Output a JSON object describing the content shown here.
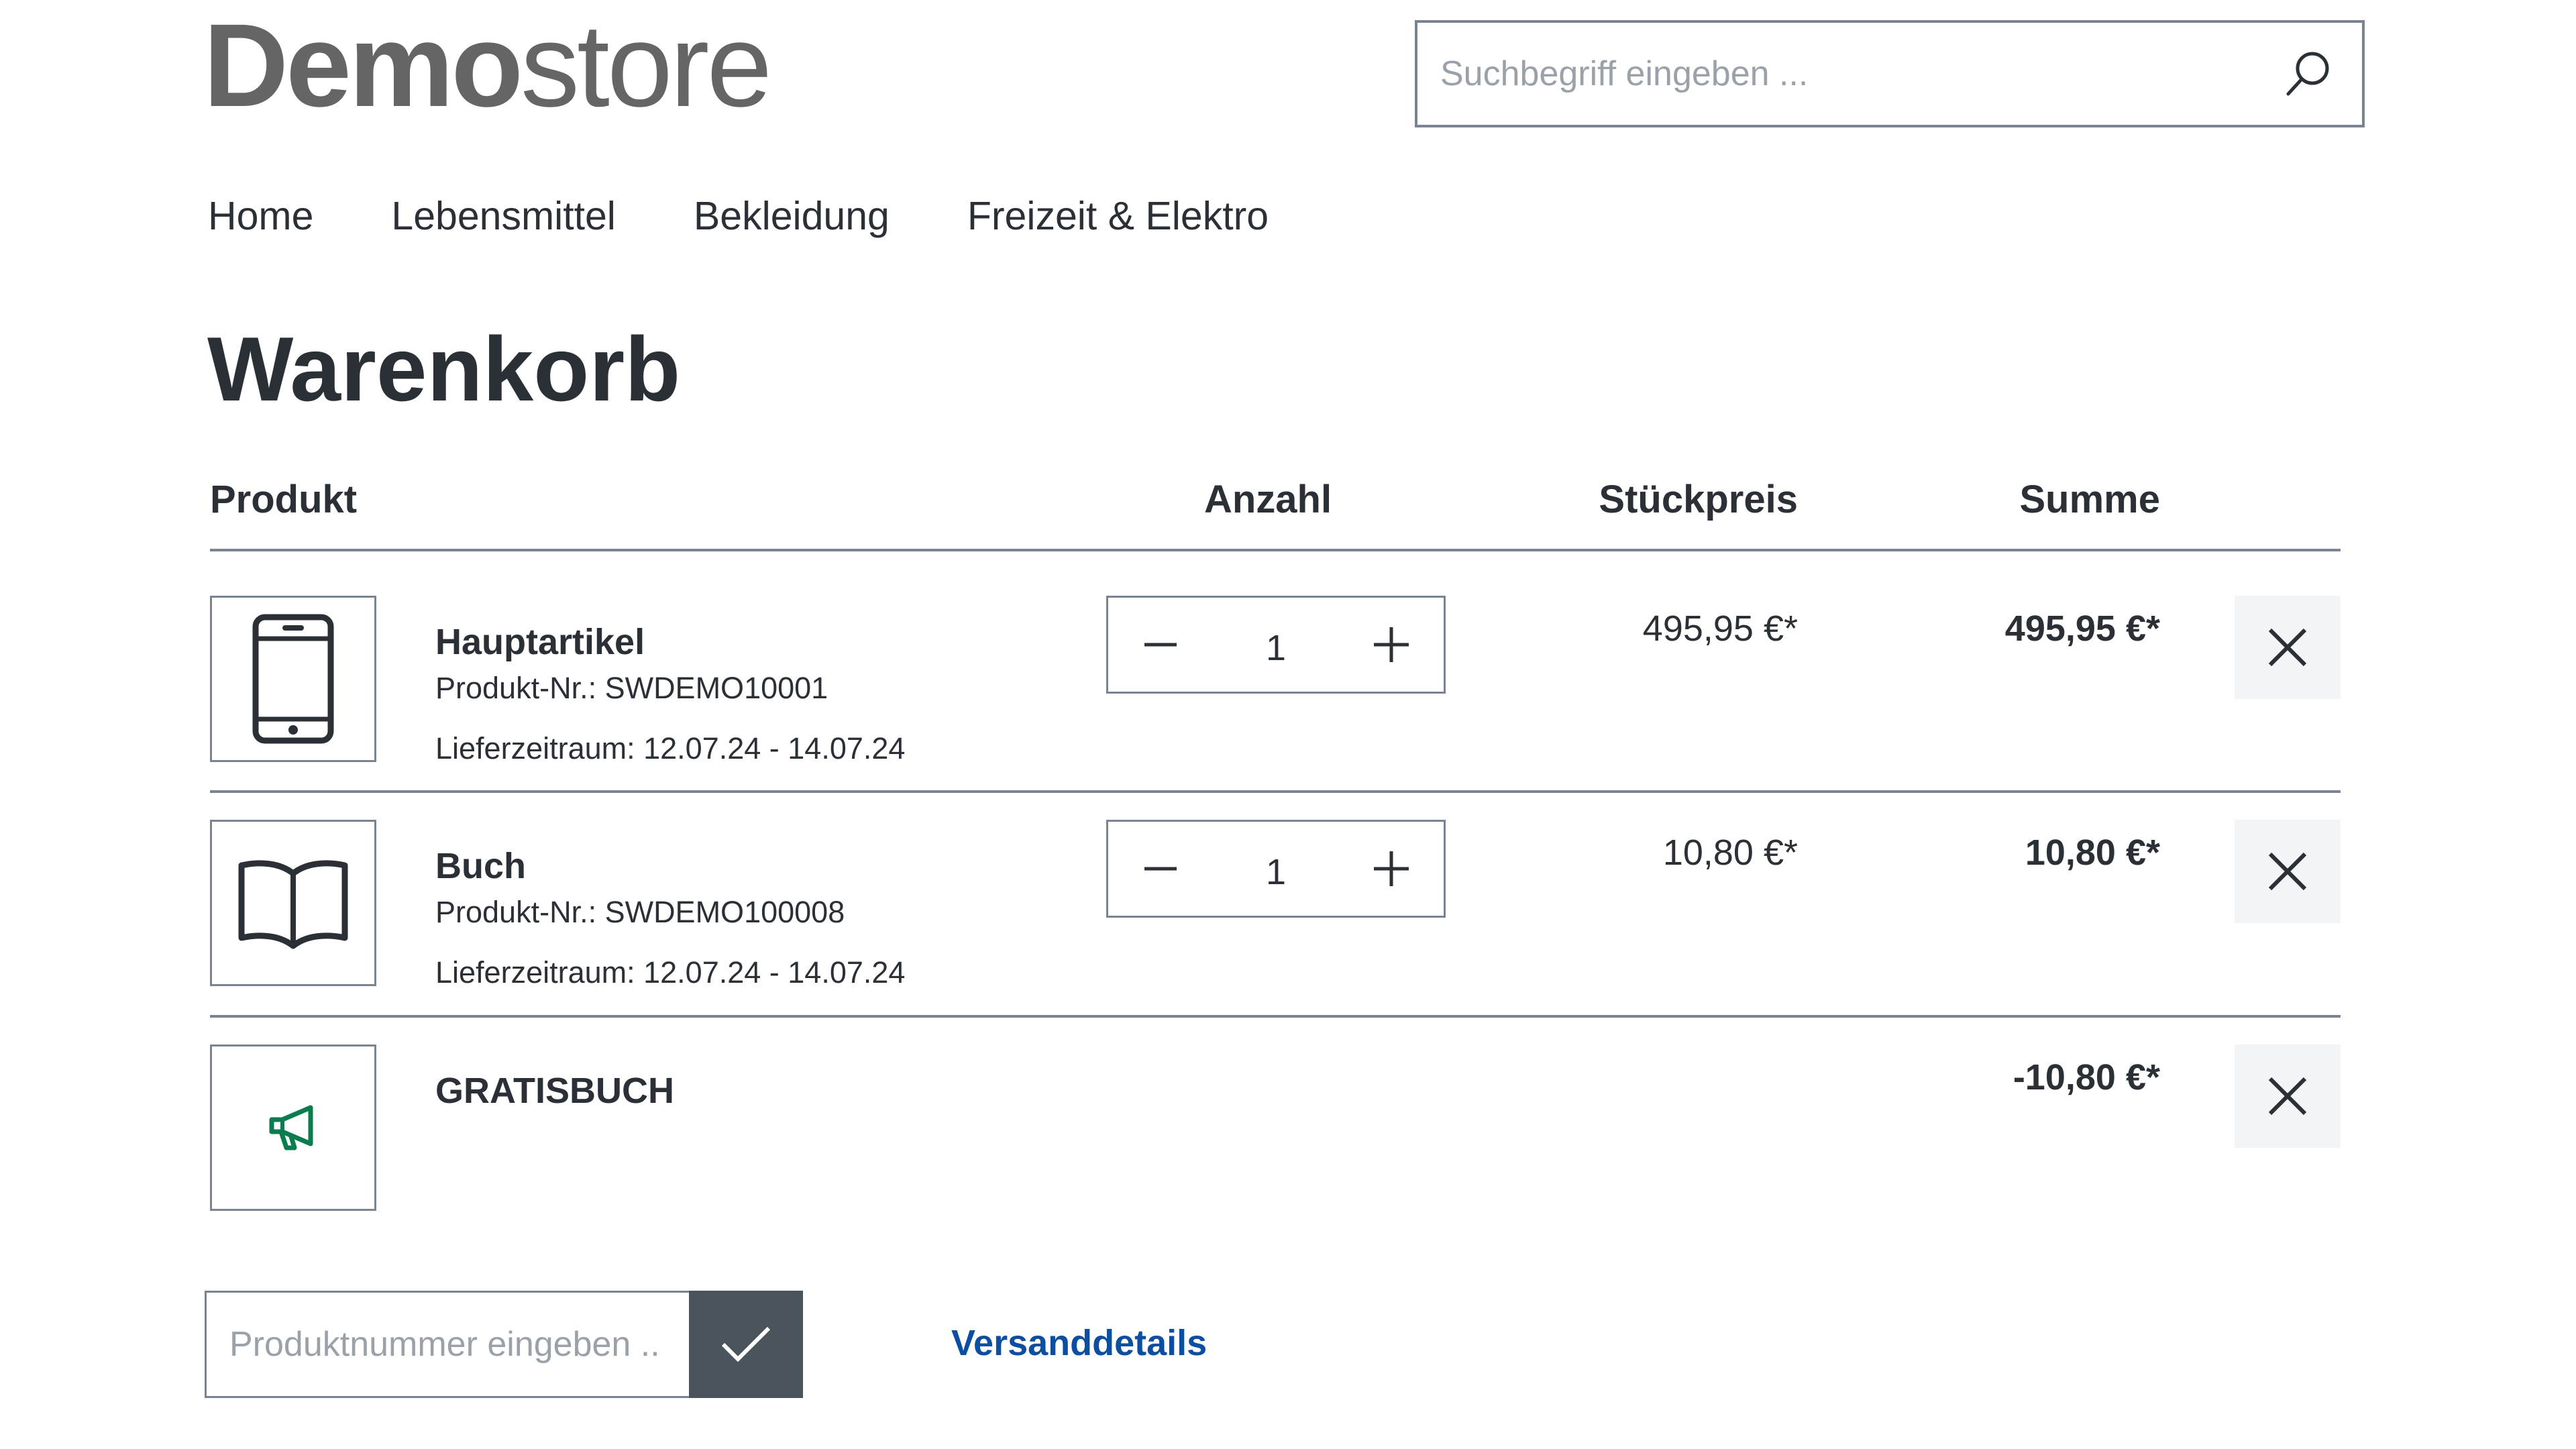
{
  "header": {
    "logo": {
      "bold": "Demo",
      "thin": "store"
    },
    "search": {
      "placeholder": "Suchbegriff eingeben ..."
    }
  },
  "nav": {
    "items": [
      {
        "label": "Home"
      },
      {
        "label": "Lebensmittel"
      },
      {
        "label": "Bekleidung"
      },
      {
        "label": "Freizeit & Elektro"
      }
    ]
  },
  "page": {
    "title": "Warenkorb"
  },
  "table": {
    "headers": {
      "product": "Produkt",
      "quantity": "Anzahl",
      "unit_price": "Stückpreis",
      "total": "Summe"
    }
  },
  "cart": {
    "items": [
      {
        "name": "Hauptartikel",
        "product_number": "Produkt-Nr.: SWDEMO10001",
        "delivery": "Lieferzeitraum: 12.07.24 - 14.07.24",
        "quantity": "1",
        "unit_price": "495,95 €*",
        "total": "495,95 €*",
        "icon": "smartphone-icon"
      },
      {
        "name": "Buch",
        "product_number": "Produkt-Nr.: SWDEMO100008",
        "delivery": "Lieferzeitraum: 12.07.24 - 14.07.24",
        "quantity": "1",
        "unit_price": "10,80 €*",
        "total": "10,80 €*",
        "icon": "book-icon"
      }
    ],
    "promotion": {
      "name": "GRATISBUCH",
      "total": "-10,80 €*",
      "icon": "megaphone-icon",
      "icon_color": "#0a7d4e"
    }
  },
  "actions": {
    "add_product_placeholder": "Produktnummer eingeben ..",
    "shipping_details": "Versanddetails"
  },
  "colors": {
    "text": "#2b2f36",
    "logo": "#656565",
    "border": "#798490",
    "link": "#0b4ea2",
    "submit_button": "#4a545b",
    "remove_button_bg": "#f3f4f5"
  }
}
